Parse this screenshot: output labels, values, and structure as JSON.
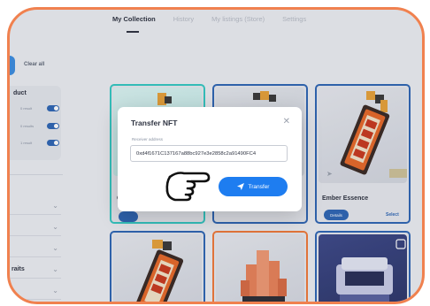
{
  "tabs": [
    {
      "label": "My Collection"
    },
    {
      "label": "History"
    },
    {
      "label": "My listings (Store)"
    },
    {
      "label": "Settings"
    }
  ],
  "sidebar": {
    "clear_all": "Clear all",
    "filter_title": "duct",
    "filters": [
      {
        "label": "0 result",
        "on": true
      },
      {
        "label": "0 results",
        "on": true
      },
      {
        "label": "1 result",
        "on": true
      }
    ],
    "traits_label": "raits"
  },
  "cards": [
    {
      "name": "C",
      "border": "#35c9c3",
      "select": ""
    },
    {
      "name": "",
      "border": "#2f67b5",
      "select": ""
    },
    {
      "name": "Ember Essence",
      "border": "#2f67b5",
      "details": "Details",
      "select": "Select"
    },
    {
      "name": "",
      "border": "#2f67b5"
    },
    {
      "name": "",
      "border": "#f07a3a"
    },
    {
      "name": "",
      "border": "#2f67b5"
    }
  ],
  "modal": {
    "title": "Transfer NFT",
    "field_label": "Receiver address",
    "address": "0xd4f1671C137167a88bc927e3e2858c2a91490FC4",
    "transfer_label": "Transfer"
  },
  "colors": {
    "frame": "#f0814f",
    "primary": "#1e7df0",
    "dark_blue": "#2f67b5",
    "teal": "#35c9c3",
    "orange": "#f07a3a"
  },
  "icons": [
    "close-icon",
    "send-icon",
    "pointing-hand-icon",
    "chevron-down-icon",
    "share-icon",
    "checkbox-icon"
  ]
}
